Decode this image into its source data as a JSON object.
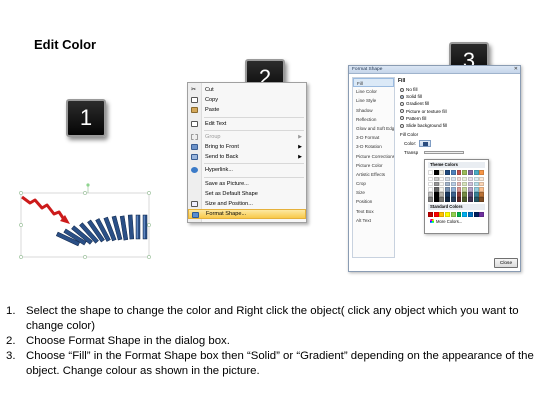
{
  "title": "Edit Color",
  "badges": {
    "step1": "1",
    "step2": "2",
    "step3": "3"
  },
  "context_menu": {
    "items": [
      {
        "label": "Cut",
        "icon": "scissors-icon",
        "disabled": false
      },
      {
        "label": "Copy",
        "icon": "copy-icon",
        "disabled": false
      },
      {
        "label": "Paste",
        "icon": "paste-icon",
        "disabled": false
      },
      {
        "label": "Edit Text",
        "icon": "edit-text-icon",
        "disabled": false
      },
      {
        "label": "Group",
        "icon": "group-icon",
        "disabled": true,
        "submenu": true
      },
      {
        "label": "Bring to Front",
        "icon": "bring-to-front-icon",
        "disabled": false,
        "submenu": true
      },
      {
        "label": "Send to Back",
        "icon": "send-to-back-icon",
        "disabled": false,
        "submenu": true
      },
      {
        "label": "Hyperlink...",
        "icon": "hyperlink-icon",
        "disabled": false
      },
      {
        "label": "Save as Picture...",
        "icon": "",
        "disabled": false
      },
      {
        "label": "Set as Default Shape",
        "icon": "",
        "disabled": false
      },
      {
        "label": "Size and Position...",
        "icon": "size-position-icon",
        "disabled": false
      },
      {
        "label": "Format Shape...",
        "icon": "format-shape-icon",
        "disabled": false,
        "highlight": true
      }
    ]
  },
  "dialog": {
    "title": "Format Shape",
    "close_label": "Close",
    "nav_items": [
      "Fill",
      "Line Color",
      "Line Style",
      "Shadow",
      "Reflection",
      "Glow and Soft Edges",
      "3-D Format",
      "3-D Rotation",
      "Picture Corrections",
      "Picture Color",
      "Artistic Effects",
      "Crop",
      "Size",
      "Position",
      "Text Box",
      "Alt Text"
    ],
    "panel_heading": "Fill",
    "fill_options": [
      "No fill",
      "Solid fill",
      "Gradient fill",
      "Picture or texture fill",
      "Pattern fill",
      "Slide background fill"
    ],
    "fill_color_heading": "Fill Color",
    "color_label": "Color:",
    "transparency_label": "Transp"
  },
  "palette": {
    "theme_heading": "Theme Colors",
    "standard_heading": "Standard Colors",
    "more_colors": "More Colors...",
    "theme_colors": [
      "#ffffff",
      "#000000",
      "#eeece1",
      "#1f497d",
      "#4f81bd",
      "#c0504d",
      "#9bbb59",
      "#8064a2",
      "#4bacc6",
      "#f79646"
    ],
    "standard_colors": [
      "#c00000",
      "#ff0000",
      "#ffc000",
      "#ffff00",
      "#92d050",
      "#00b050",
      "#00b0f0",
      "#0070c0",
      "#002060",
      "#7030a0"
    ]
  },
  "instructions": [
    {
      "num": "1.",
      "text": "Select the shape to change the color and Right click the object( click any object which you want to change color)"
    },
    {
      "num": "2.",
      "text": "Choose Format Shape in the dialog box."
    },
    {
      "num": "3.",
      "text": "Choose “Fill” in the Format Shape box then “Solid” or “Gradient” depending on the appearance of the object. Change colour as shown in the picture."
    }
  ]
}
